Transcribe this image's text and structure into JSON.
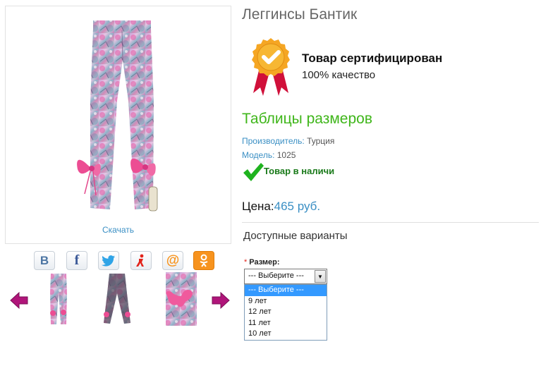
{
  "product": {
    "title": "Леггинсы Бантик",
    "image_download": "Скачать"
  },
  "share": [
    {
      "name": "vk-share-icon",
      "glyph": "B",
      "color": "#4c75a3"
    },
    {
      "name": "facebook-share-icon",
      "glyph": "f",
      "color": "#3b5998"
    },
    {
      "name": "twitter-share-icon",
      "glyph": "bird",
      "color": "#2fa4e7"
    },
    {
      "name": "moimir-share-icon",
      "glyph": "person",
      "color": "#e2231a"
    },
    {
      "name": "mailru-share-icon",
      "glyph": "@",
      "color": "#f7941d"
    },
    {
      "name": "odnoklassniki-share-icon",
      "glyph": "ok",
      "color": "#f7931e"
    }
  ],
  "certificate": {
    "title": "Товар сертифицирован",
    "subtitle": "100% качество"
  },
  "size_table_link": "Таблицы размеров",
  "specs": {
    "manufacturer_label": "Производитель:",
    "manufacturer_value": " Турция",
    "model_label": "Модель:",
    "model_value": " 1025"
  },
  "stock": "Товар в наличи",
  "price": {
    "label": "Цена:",
    "value": "465 руб."
  },
  "variants": {
    "title": "Доступные варианты",
    "required_mark": "*",
    "size_label": "Размер:",
    "selected": "--- Выберите ---",
    "options": [
      "--- Выберите ---",
      "9 лет",
      "12 лет",
      "11 лет",
      "10 лет"
    ]
  },
  "colors": {
    "link_blue": "#3a8fc4",
    "green_link": "#3fb61a",
    "stock_green": "#1a7a1a",
    "badge_orange": "#f5a623",
    "ribbon_red": "#d0103a",
    "arrow_magenta": "#b0157a"
  }
}
